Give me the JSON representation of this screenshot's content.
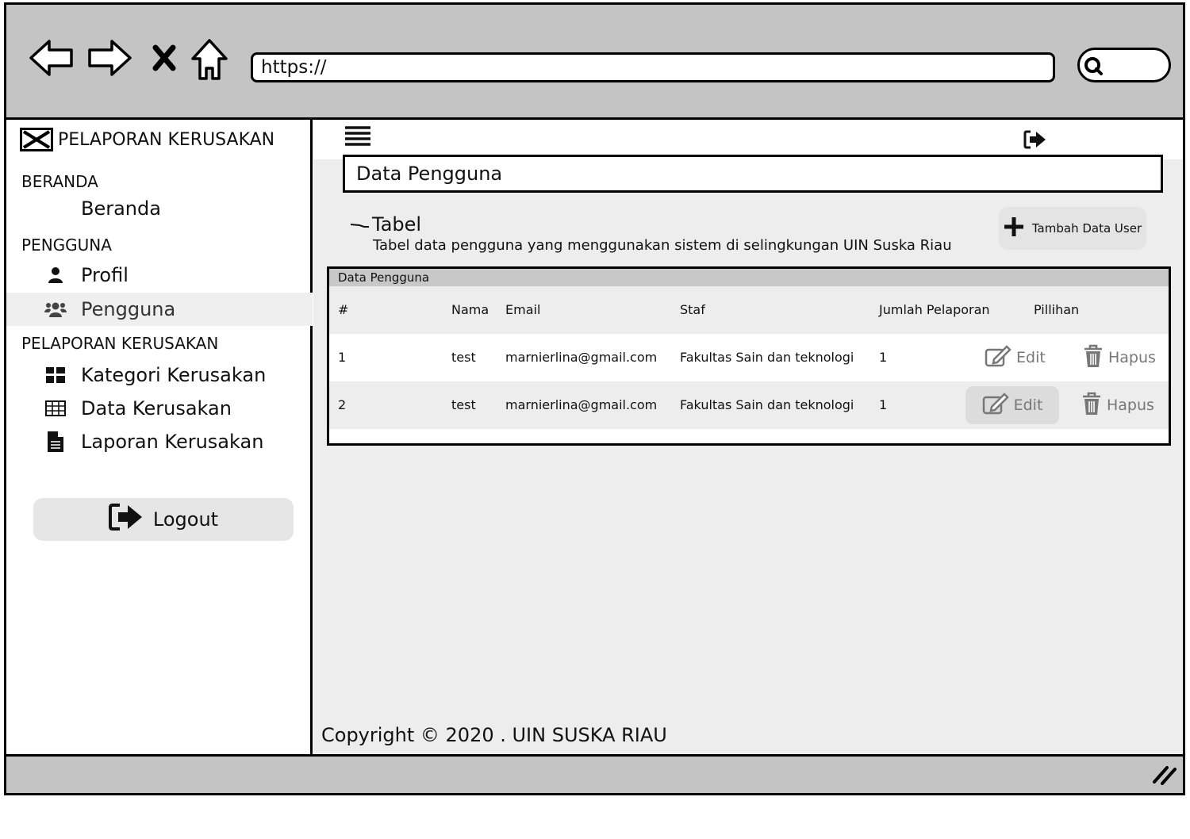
{
  "browser": {
    "url": "https://",
    "back_icon": "back-arrow-icon",
    "forward_icon": "forward-arrow-icon",
    "close_icon": "close-x-icon",
    "home_icon": "home-icon",
    "search_icon": "search-icon"
  },
  "sidebar": {
    "brand": "PELAPORAN KERUSAKAN",
    "sections": [
      {
        "label": "BERANDA",
        "items": [
          {
            "label": "Beranda",
            "icon": ""
          }
        ]
      },
      {
        "label": "PENGGUNA",
        "items": [
          {
            "label": "Profil",
            "icon": "user-icon"
          },
          {
            "label": "Pengguna",
            "icon": "users-icon",
            "active": true
          }
        ]
      },
      {
        "label": "PELAPORAN KERUSAKAN",
        "items": [
          {
            "label": "Kategori Kerusakan",
            "icon": "grid-icon"
          },
          {
            "label": "Data Kerusakan",
            "icon": "table-icon"
          },
          {
            "label": "Laporan Kerusakan",
            "icon": "document-icon"
          }
        ]
      }
    ],
    "logout": "Logout"
  },
  "main": {
    "page_title": "Data Pengguna",
    "table_title": "Tabel",
    "table_desc": "Tabel data pengguna yang menggunakan sistem di selingkungan UIN Suska Riau",
    "add_button": "Tambah Data User",
    "card_title": "Data Pengguna",
    "columns": [
      "#",
      "Nama",
      "Email",
      "Staf",
      "Jumlah Pelaporan",
      "Pillihan"
    ],
    "rows": [
      {
        "no": "1",
        "nama": "test",
        "email": "marnierlina@gmail.com",
        "staf": "Fakultas Sain dan teknologi",
        "jumlah": "1",
        "edit": "Edit",
        "hapus": "Hapus"
      },
      {
        "no": "2",
        "nama": "test",
        "email": "marnierlina@gmail.com",
        "staf": "Fakultas Sain dan teknologi",
        "jumlah": "1",
        "edit": "Edit",
        "hapus": "Hapus"
      }
    ],
    "footer": "Copyright © 2020 . UIN SUSKA RIAU"
  }
}
